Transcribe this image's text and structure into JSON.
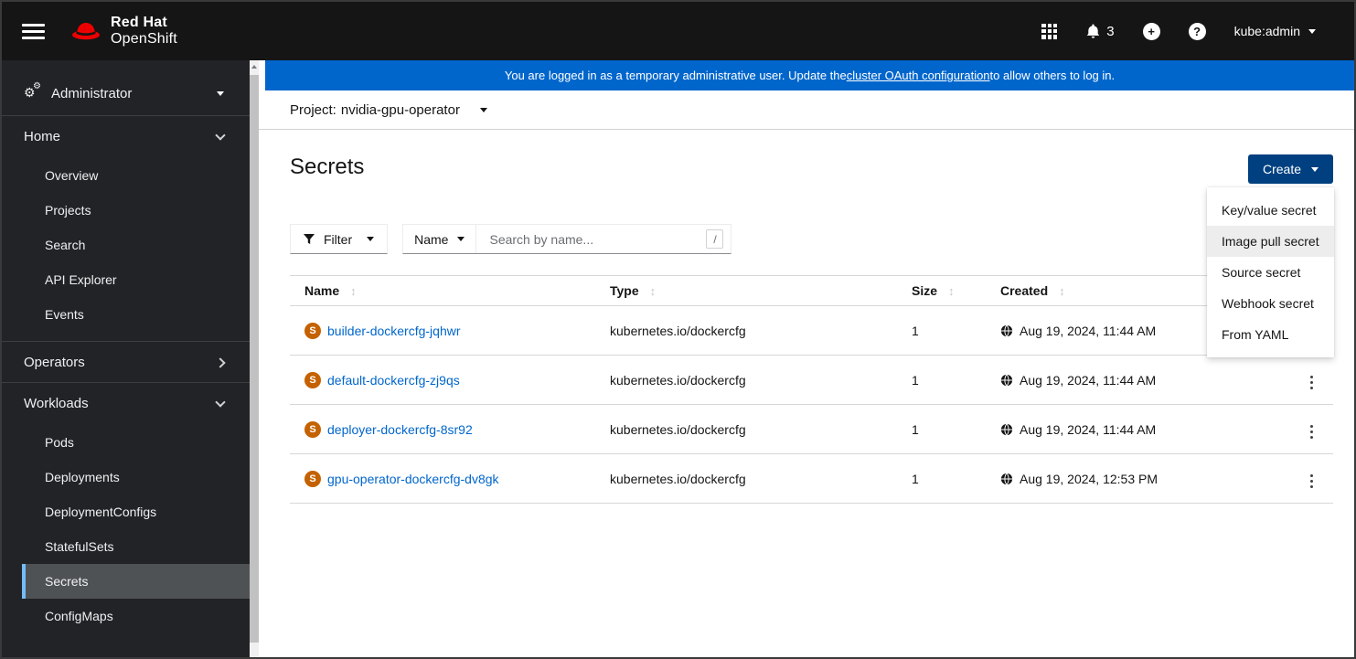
{
  "masthead": {
    "brand_line1": "Red Hat",
    "brand_line2": "OpenShift",
    "notification_count": "3",
    "username": "kube:admin"
  },
  "icons": {
    "help_glyph": "?",
    "plus_glyph": "+",
    "sort_glyph": "↕",
    "gear_glyph": "⚙"
  },
  "banner": {
    "prefix": "You are logged in as a temporary administrative user. Update the ",
    "link_text": "cluster OAuth configuration",
    "suffix": " to allow others to log in."
  },
  "project_bar": {
    "label": "Project:",
    "name": "nvidia-gpu-operator"
  },
  "sidebar": {
    "perspective": "Administrator",
    "home_label": "Home",
    "home_items": [
      "Overview",
      "Projects",
      "Search",
      "API Explorer",
      "Events"
    ],
    "operators_label": "Operators",
    "workloads_label": "Workloads",
    "workloads_items": [
      "Pods",
      "Deployments",
      "DeploymentConfigs",
      "StatefulSets",
      "Secrets",
      "ConfigMaps"
    ],
    "selected_item": "Secrets"
  },
  "page": {
    "title": "Secrets",
    "create_label": "Create",
    "create_menu_items": [
      "Key/value secret",
      "Image pull secret",
      "Source secret",
      "Webhook secret",
      "From YAML"
    ],
    "highlighted_menu_item": "Image pull secret"
  },
  "toolbar": {
    "filter_label": "Filter",
    "name_label": "Name",
    "search_placeholder": "Search by name...",
    "search_shortcut": "/"
  },
  "table": {
    "headers": [
      "Name",
      "Type",
      "Size",
      "Created"
    ],
    "badge_letter": "S",
    "rows": [
      {
        "name": "builder-dockercfg-jqhwr",
        "type": "kubernetes.io/dockercfg",
        "size": "1",
        "created": "Aug 19, 2024, 11:44 AM"
      },
      {
        "name": "default-dockercfg-zj9qs",
        "type": "kubernetes.io/dockercfg",
        "size": "1",
        "created": "Aug 19, 2024, 11:44 AM"
      },
      {
        "name": "deployer-dockercfg-8sr92",
        "type": "kubernetes.io/dockercfg",
        "size": "1",
        "created": "Aug 19, 2024, 11:44 AM"
      },
      {
        "name": "gpu-operator-dockercfg-dv8gk",
        "type": "kubernetes.io/dockercfg",
        "size": "1",
        "created": "Aug 19, 2024, 12:53 PM"
      }
    ]
  },
  "colors": {
    "banner_blue": "#0066cc",
    "create_button_blue": "#004080",
    "link_blue": "#0066cc",
    "secret_badge_orange": "#c46100",
    "sidebar_selected_bg": "#4f5255",
    "sidebar_selected_border": "#73bcf7",
    "masthead_black": "#151515",
    "sidebar_dark": "#212327"
  }
}
